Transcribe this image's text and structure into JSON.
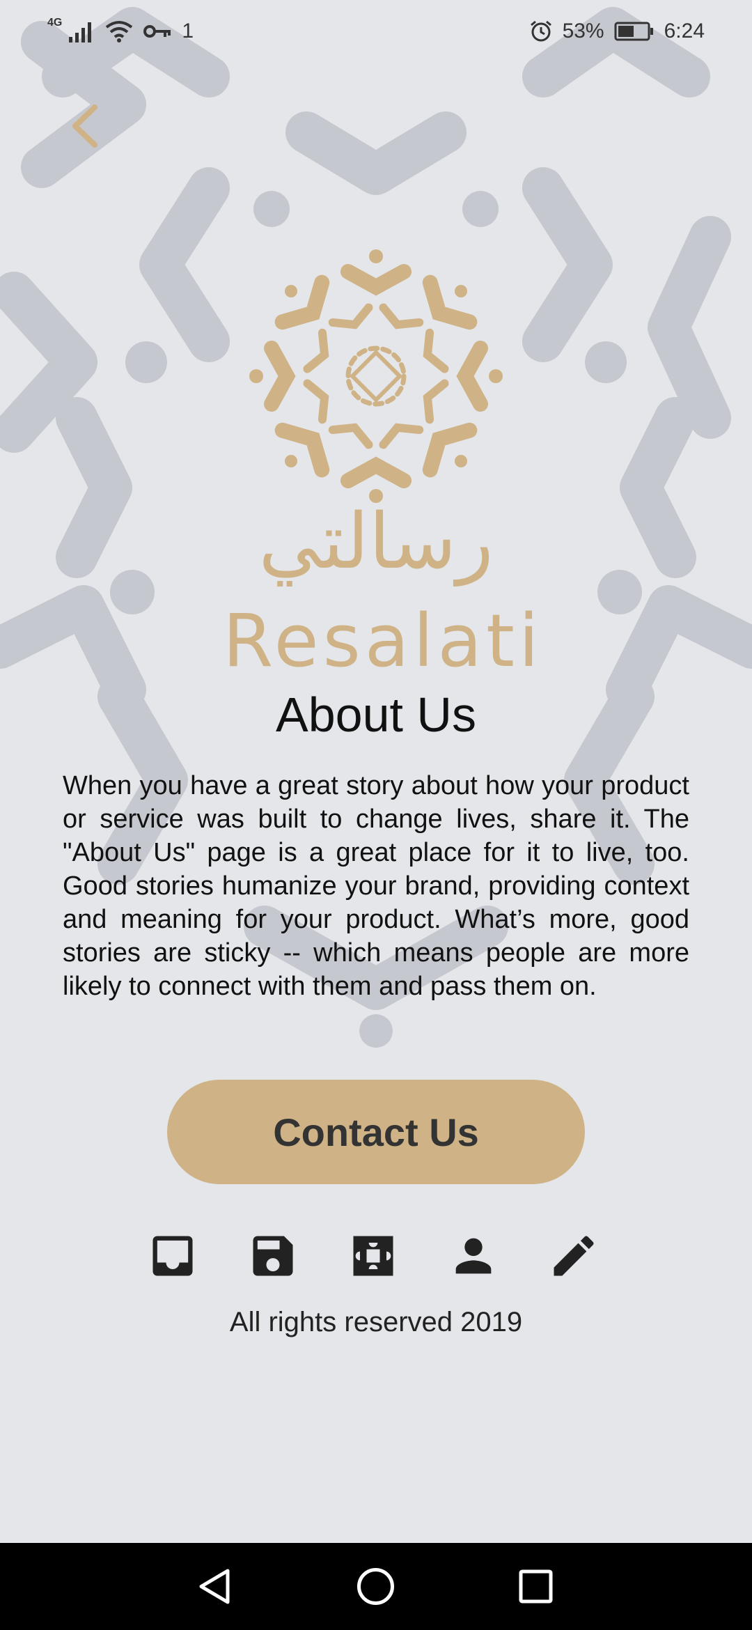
{
  "status_bar": {
    "network": "4G",
    "sim_slot": "1",
    "battery": "53%",
    "time": "6:24"
  },
  "logo": {
    "arabic_name": "رسالتي",
    "latin_name": "Resalati"
  },
  "about": {
    "title": "About Us",
    "body": "When you have a great story about how your product or service was built to change lives, share it. The \"About Us\" page is a great place for it to live, too. Good stories humanize your brand, providing context and meaning for your product. What’s more, good stories are sticky -- which means people are more likely to connect with them and pass them on."
  },
  "contact_button": {
    "label": "Contact Us"
  },
  "icons": [
    "inbox-icon",
    "save-icon",
    "puzzle-icon",
    "person-icon",
    "pencil-icon"
  ],
  "footer": {
    "text": "All rights reserved 2019"
  },
  "colors": {
    "accent": "#cfb386",
    "background": "#e4e6ea",
    "pattern": "#c6c8cf",
    "text": "#111111",
    "nav_bar": "#000000"
  }
}
